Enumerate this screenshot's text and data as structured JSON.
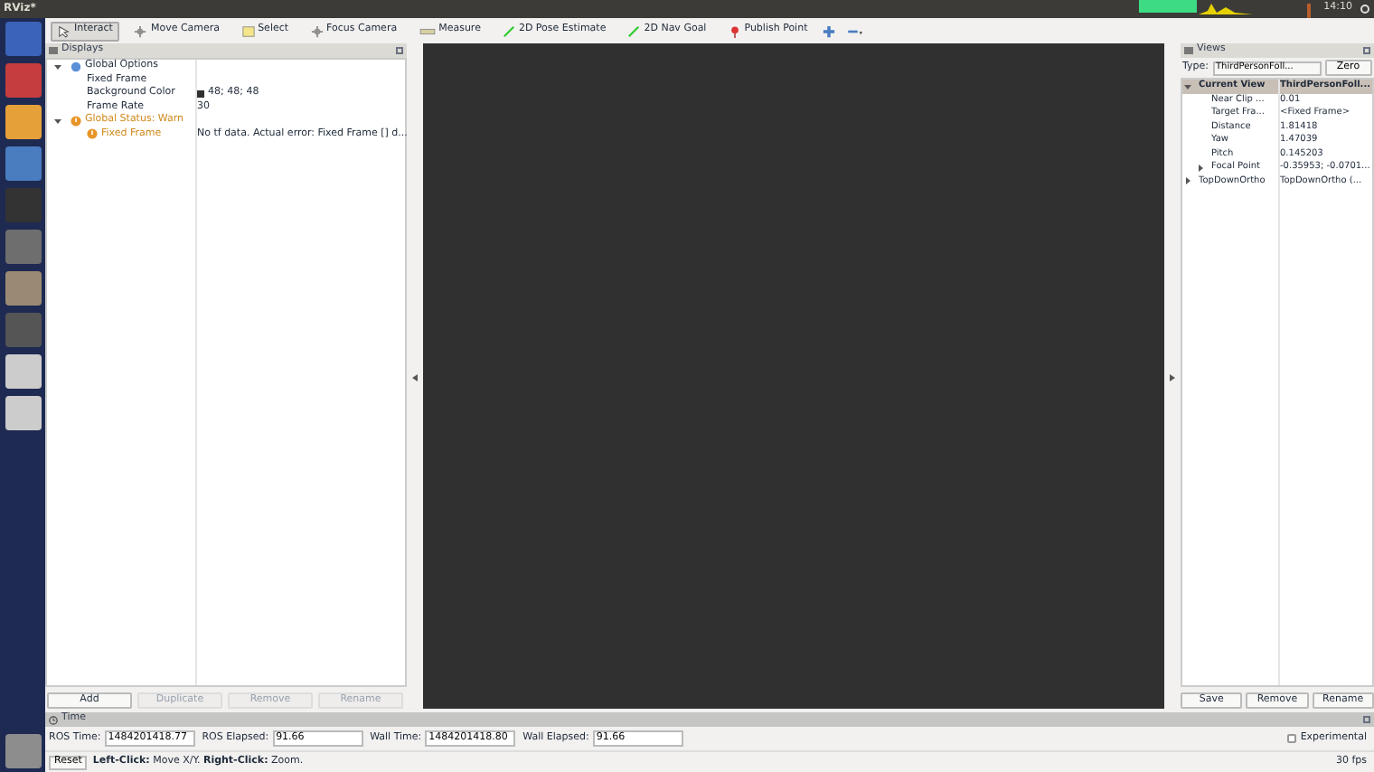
{
  "window": {
    "title": "RViz*"
  },
  "tray": {
    "clock": "14:10"
  },
  "toolbar": [
    {
      "label": "Interact",
      "selected": true
    },
    {
      "label": "Move Camera",
      "selected": false
    },
    {
      "label": "Select",
      "selected": false
    },
    {
      "label": "Focus Camera",
      "selected": false
    },
    {
      "label": "Measure",
      "selected": false
    },
    {
      "label": "2D Pose Estimate",
      "selected": false
    },
    {
      "label": "2D Nav Goal",
      "selected": false
    },
    {
      "label": "Publish Point",
      "selected": false
    }
  ],
  "displays": {
    "title": "Displays",
    "tree": [
      {
        "label": "Global Options",
        "kind": "options",
        "expanded": true,
        "children": [
          {
            "label": "Fixed Frame"
          },
          {
            "label": "Background Color",
            "value": "48; 48; 48",
            "color": "#303030"
          },
          {
            "label": "Frame Rate",
            "value": "30"
          }
        ]
      },
      {
        "label": "Global Status: Warn",
        "kind": "warn",
        "expanded": true,
        "children": [
          {
            "label": "Fixed Frame",
            "kind": "warn",
            "value": "No tf data.  Actual error: Fixed Frame [] d..."
          }
        ]
      }
    ],
    "buttons": [
      {
        "label": "Add",
        "disabled": false
      },
      {
        "label": "Duplicate",
        "disabled": true
      },
      {
        "label": "Remove",
        "disabled": true
      },
      {
        "label": "Rename",
        "disabled": true
      }
    ]
  },
  "views": {
    "title": "Views",
    "type_label": "Type:",
    "type_value": "ThirdPersonFoll...",
    "zero": "Zero",
    "tree": [
      {
        "label": "Current View",
        "value": "ThirdPersonFoll...",
        "expanded": true,
        "selected": true,
        "children": [
          {
            "label": "Near Clip ...",
            "value": "0.01"
          },
          {
            "label": "Target Fra...",
            "value": "<Fixed Frame>"
          },
          {
            "label": "Distance",
            "value": "1.81418"
          },
          {
            "label": "Yaw",
            "value": "1.47039"
          },
          {
            "label": "Pitch",
            "value": "0.145203"
          },
          {
            "label": "Focal Point",
            "value": "-0.35953; -0.0701...",
            "expanded": false
          }
        ]
      },
      {
        "label": "TopDownOrtho",
        "value": "TopDownOrtho (...",
        "expanded": false,
        "selected": false
      }
    ],
    "buttons": [
      "Save",
      "Remove",
      "Rename"
    ]
  },
  "time": {
    "title": "Time",
    "fields": [
      {
        "label": "ROS Time:",
        "value": "1484201418.77"
      },
      {
        "label": "ROS Elapsed:",
        "value": "91.66"
      },
      {
        "label": "Wall Time:",
        "value": "1484201418.80"
      },
      {
        "label": "Wall Elapsed:",
        "value": "91.66"
      }
    ],
    "experimental": {
      "label": "Experimental",
      "checked": false
    }
  },
  "status": {
    "reset": "Reset",
    "hint": "**Left-Click:** Move X/Y. **Right-Click:** Zoom.",
    "fps": "30 fps"
  }
}
